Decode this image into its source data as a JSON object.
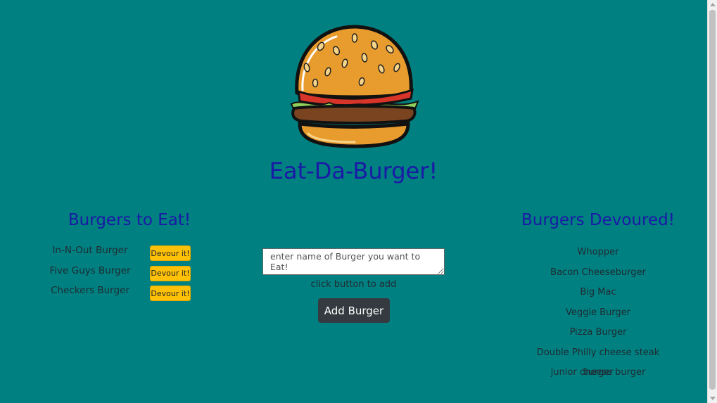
{
  "app": {
    "title": "Eat-Da-Burger!"
  },
  "colors": {
    "background": "#008080",
    "heading": "#1a1aa6",
    "devour_button": "#ffc107",
    "add_button": "#343a40"
  },
  "logo": {
    "icon": "burger-logo"
  },
  "left": {
    "title": "Burgers to Eat!",
    "items": [
      {
        "name": "In-N-Out Burger",
        "button": "Devour it!"
      },
      {
        "name": "Five Guys Burger",
        "button": "Devour it!"
      },
      {
        "name": "Checkers Burger",
        "button": "Devour it!"
      }
    ]
  },
  "form": {
    "placeholder": "enter name of Burger you want to Eat!",
    "value": "",
    "helper": "click button to add",
    "submit_label": "Add Burger"
  },
  "right": {
    "title": "Burgers Devoured!",
    "items": [
      "Whopper",
      "Bacon Cheeseburger",
      "Big Mac",
      "Veggie Burger",
      "Pizza Burger",
      "Double Philly cheese steak burger",
      "junior cheese burger"
    ]
  }
}
